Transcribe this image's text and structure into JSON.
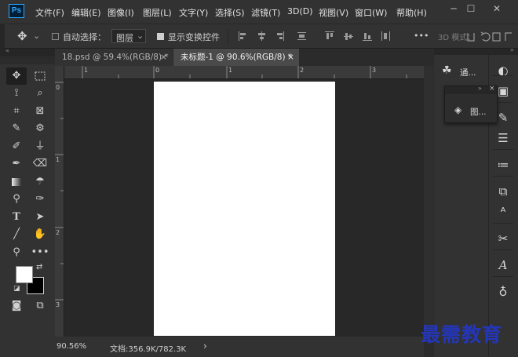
{
  "app": {
    "logo_text": "Ps"
  },
  "menu": [
    "文件(F)",
    "编辑(E)",
    "图像(I)",
    "图层(L)",
    "文字(Y)",
    "选择(S)",
    "滤镜(T)",
    "3D(D)",
    "视图(V)",
    "窗口(W)",
    "帮助(H)"
  ],
  "window_controls": {
    "minimize": "─",
    "maximize": "☐",
    "close": "✕"
  },
  "options_bar": {
    "move_icon": "✥",
    "dropdown_arrow": "⌄",
    "auto_select_label": "自动选择：",
    "auto_select_checked": false,
    "target_value": "图层",
    "show_transform_label": "显示变换控件",
    "show_transform_checked": true,
    "more_label": "•••",
    "mode_3d_label": "3D 模式："
  },
  "tabs": [
    {
      "label": "18.psd @ 59.4%(RGB/8) *",
      "active": false
    },
    {
      "label": "未标题-1 @ 90.6%(RGB/8) *",
      "active": true
    }
  ],
  "tab_close_glyph": "×",
  "ruler": {
    "top_labels": [
      "1",
      "0",
      "1",
      "2",
      "3"
    ],
    "left_labels": [
      "0",
      "1",
      "2",
      "3"
    ]
  },
  "status": {
    "zoom": "90.56%",
    "doc_info": "文档:356.9K/782.3K",
    "arrow": "›"
  },
  "right_panels": {
    "channels_label": "通...",
    "layers_label": "图..."
  },
  "colors": {
    "foreground": "#ffffff",
    "background": "#000000",
    "accent": "#31a8ff",
    "watermark": "#2436b8"
  },
  "watermark_text": "最需教育"
}
